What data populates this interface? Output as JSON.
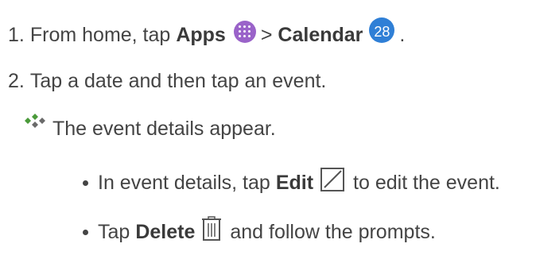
{
  "steps": [
    {
      "number": "1.",
      "prefix": "From home, tap",
      "apps_label": "Apps",
      "separator": ">",
      "calendar_label": "Calendar",
      "suffix": "."
    },
    {
      "number": "2.",
      "text": "Tap a date and then tap an event."
    }
  ],
  "result": {
    "text": "The event details appear.",
    "icon": "diamond-bullet-icon"
  },
  "substeps": [
    {
      "prefix": "In event details, tap",
      "bold": "Edit",
      "icon": "edit-icon",
      "suffix": "to edit the event."
    },
    {
      "prefix": "Tap",
      "bold": "Delete",
      "icon": "trash-icon",
      "suffix": "and follow the prompts."
    }
  ],
  "icons": {
    "apps": {
      "name": "apps-icon",
      "color": "#9a63c9"
    },
    "calendar": {
      "name": "calendar-icon",
      "color": "#2f7fd6",
      "day": "28"
    }
  },
  "colors": {
    "text": "#444444",
    "bullet_green": "#4a9a3a",
    "bullet_gray": "#6a6a6a"
  }
}
